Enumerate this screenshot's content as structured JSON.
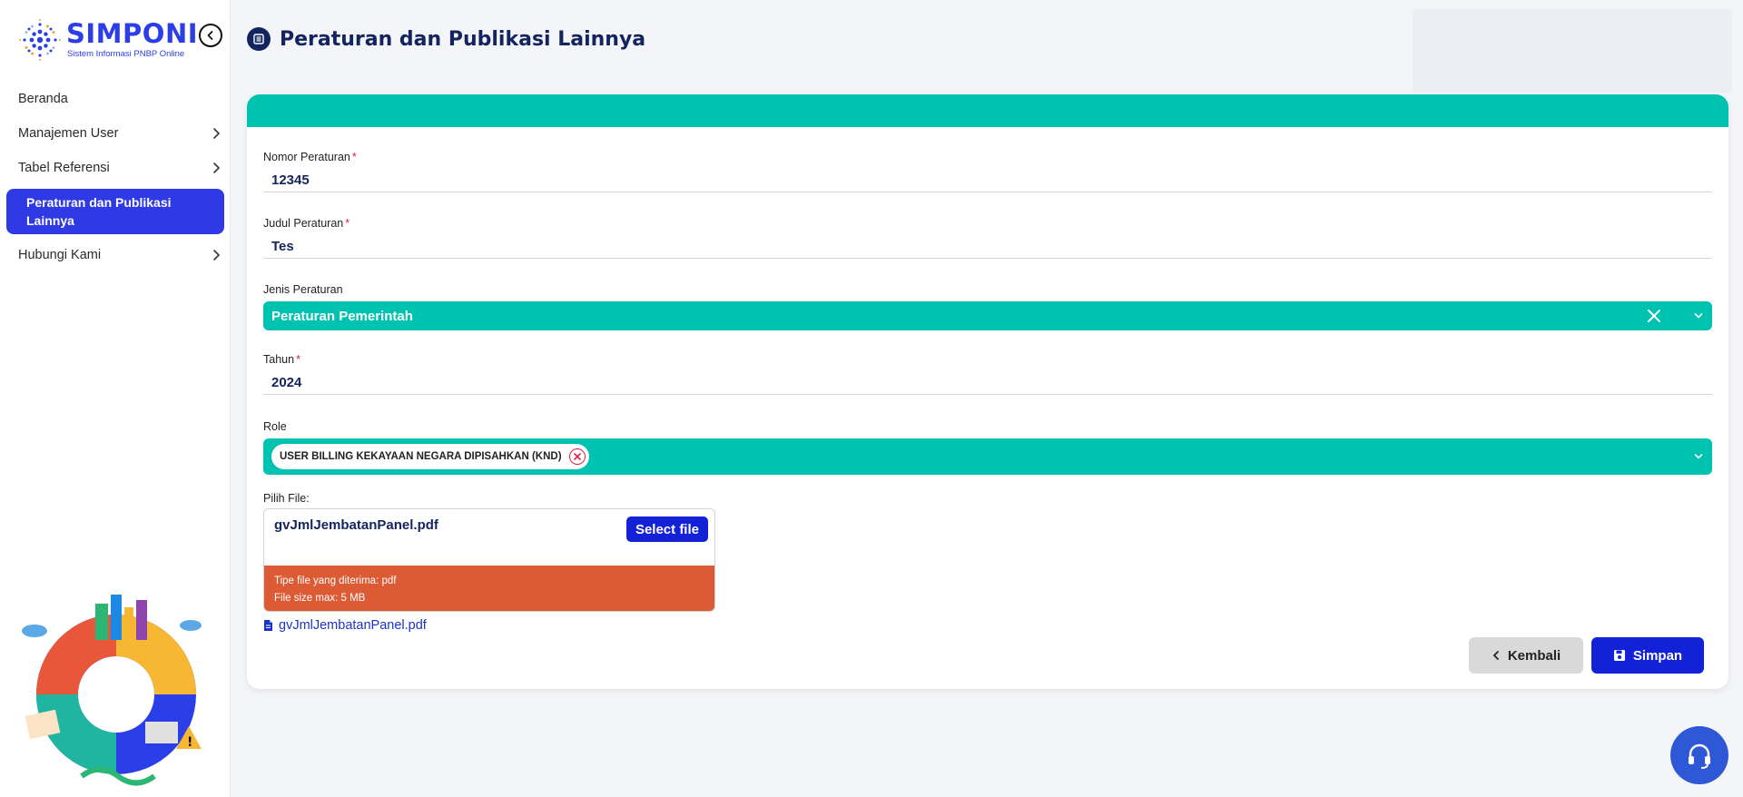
{
  "app": {
    "name": "SIMPONI",
    "subtitle": "Sistem Informasi PNBP Online"
  },
  "sidebar": {
    "items": [
      {
        "label": "Beranda",
        "has_children": false,
        "active": false
      },
      {
        "label": "Manajemen User",
        "has_children": true,
        "active": false
      },
      {
        "label": "Tabel Referensi",
        "has_children": true,
        "active": false
      },
      {
        "label": "Peraturan dan Publikasi Lainnya",
        "has_children": false,
        "active": true
      },
      {
        "label": "Hubungi Kami",
        "has_children": true,
        "active": false
      }
    ]
  },
  "page": {
    "title": "Peraturan dan Publikasi Lainnya",
    "icon": "list-icon"
  },
  "form": {
    "nomor": {
      "label": "Nomor Peraturan",
      "required_mark": "*",
      "value": "12345"
    },
    "judul": {
      "label": "Judul Peraturan",
      "required_mark": "*",
      "value": "Tes"
    },
    "jenis": {
      "label": "Jenis Peraturan",
      "value": "Peraturan Pemerintah"
    },
    "tahun": {
      "label": "Tahun",
      "required_mark": "*",
      "value": "2024"
    },
    "role": {
      "label": "Role",
      "tags": [
        "USER BILLING KEKAYAAN NEGARA DIPISAHKAN (KND)"
      ]
    },
    "file": {
      "label": "Pilih File:",
      "selected_name": "gvJmlJembatanPanel.pdf",
      "button_label": "Select file",
      "info_line1": "Tipe file yang diterima: pdf",
      "info_line2": "File size max: 5 MB",
      "existing_link": "gvJmlJembatanPanel.pdf"
    }
  },
  "actions": {
    "back_label": "Kembali",
    "save_label": "Simpan"
  },
  "colors": {
    "primary": "#2f3ae5",
    "button_primary": "#1322d6",
    "teal": "#00c2b0",
    "warning": "#dc5b35",
    "title": "#14245e"
  }
}
